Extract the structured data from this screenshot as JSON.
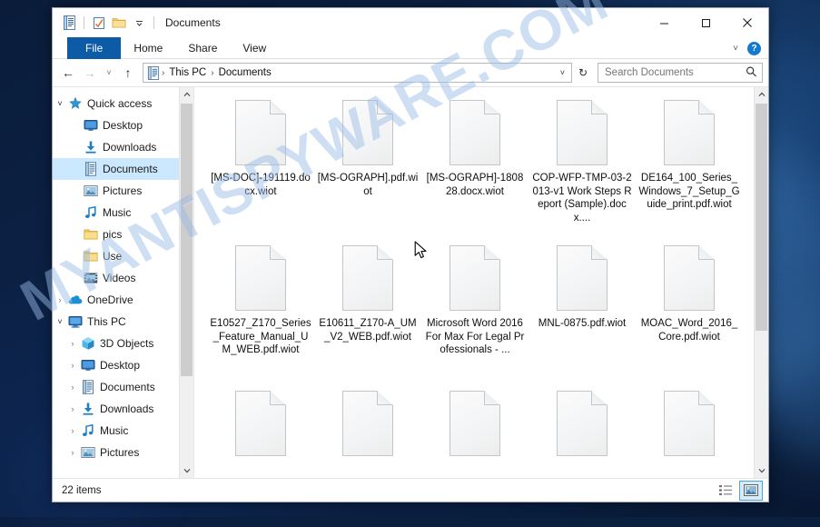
{
  "window": {
    "title": "Documents",
    "quick_access_toolbar": [
      {
        "name": "properties-icon",
        "label": "Properties"
      },
      {
        "name": "new-folder-icon",
        "label": "New folder"
      },
      {
        "name": "customize-qat-chevron-icon",
        "label": "Customize Quick Access Toolbar"
      }
    ],
    "controls": {
      "minimize": "─",
      "maximize": "☐",
      "close": "✕"
    }
  },
  "ribbon": {
    "tabs": [
      {
        "label": "File",
        "active": true
      },
      {
        "label": "Home",
        "active": false
      },
      {
        "label": "Share",
        "active": false
      },
      {
        "label": "View",
        "active": false
      }
    ],
    "expand_chevron": "˅",
    "help_label": "?"
  },
  "address_bar": {
    "back": "←",
    "forward": "→",
    "recent": "˅",
    "up": "↑",
    "breadcrumbs": [
      "This PC",
      "Documents"
    ],
    "separator": "›",
    "dropdown_chevron": "˅",
    "refresh": "↻"
  },
  "search": {
    "placeholder": "Search Documents",
    "value": "",
    "icon": "search-icon"
  },
  "sidebar": {
    "groups": [
      {
        "label": "Quick access",
        "icon": "pin-star-icon",
        "expander": "˅",
        "level": 1,
        "selected": false,
        "pinned": false
      },
      {
        "label": "Desktop",
        "icon": "desktop-icon",
        "level": 2,
        "selected": false,
        "pinned": true
      },
      {
        "label": "Downloads",
        "icon": "downloads-icon",
        "level": 2,
        "selected": false,
        "pinned": true
      },
      {
        "label": "Documents",
        "icon": "documents-icon",
        "level": 2,
        "selected": true,
        "pinned": true
      },
      {
        "label": "Pictures",
        "icon": "pictures-icon",
        "level": 2,
        "selected": false,
        "pinned": true
      },
      {
        "label": "Music",
        "icon": "music-icon",
        "level": 2,
        "selected": false,
        "pinned": false
      },
      {
        "label": "pics",
        "icon": "folder-icon",
        "level": 2,
        "selected": false,
        "pinned": false
      },
      {
        "label": "Use",
        "icon": "folder-icon",
        "level": 2,
        "selected": false,
        "pinned": false
      },
      {
        "label": "Videos",
        "icon": "videos-icon",
        "level": 2,
        "selected": false,
        "pinned": false
      },
      {
        "label": "OneDrive",
        "icon": "onedrive-icon",
        "expander": "›",
        "level": 1,
        "selected": false,
        "pinned": false
      },
      {
        "label": "This PC",
        "icon": "thispc-icon",
        "expander": "˅",
        "level": 1,
        "selected": false,
        "pinned": false
      },
      {
        "label": "3D Objects",
        "icon": "3dobjects-icon",
        "expander": "›",
        "level": 2,
        "selected": false,
        "pinned": false
      },
      {
        "label": "Desktop",
        "icon": "desktop-icon",
        "expander": "›",
        "level": 2,
        "selected": false,
        "pinned": false
      },
      {
        "label": "Documents",
        "icon": "documents-icon",
        "expander": "›",
        "level": 2,
        "selected": false,
        "pinned": false
      },
      {
        "label": "Downloads",
        "icon": "downloads-icon",
        "expander": "›",
        "level": 2,
        "selected": false,
        "pinned": false
      },
      {
        "label": "Music",
        "icon": "music-icon",
        "expander": "›",
        "level": 2,
        "selected": false,
        "pinned": false
      },
      {
        "label": "Pictures",
        "icon": "pictures-icon",
        "expander": "›",
        "level": 2,
        "selected": false,
        "pinned": false
      }
    ],
    "pin_glyph": "📌"
  },
  "files": [
    {
      "name": "[MS-DOC]-191119.docx.wiot",
      "icon": "blank-file-icon"
    },
    {
      "name": "[MS-OGRAPH].pdf.wiot",
      "icon": "blank-file-icon"
    },
    {
      "name": "[MS-OGRAPH]-180828.docx.wiot",
      "icon": "blank-file-icon"
    },
    {
      "name": "COP-WFP-TMP-03-2013-v1 Work Steps Report (Sample).docx....",
      "icon": "blank-file-icon"
    },
    {
      "name": "DE164_100_Series_Windows_7_Setup_Guide_print.pdf.wiot",
      "icon": "blank-file-icon"
    },
    {
      "name": "E10527_Z170_Series_Feature_Manual_UM_WEB.pdf.wiot",
      "icon": "blank-file-icon"
    },
    {
      "name": "E10611_Z170-A_UM_V2_WEB.pdf.wiot",
      "icon": "blank-file-icon"
    },
    {
      "name": "Microsoft Word 2016 For Max For Legal Professionals - ...",
      "icon": "blank-file-icon"
    },
    {
      "name": "MNL-0875.pdf.wiot",
      "icon": "blank-file-icon"
    },
    {
      "name": "MOAC_Word_2016_Core.pdf.wiot",
      "icon": "blank-file-icon"
    },
    {
      "name": "",
      "icon": "blank-file-icon"
    },
    {
      "name": "",
      "icon": "blank-file-icon"
    },
    {
      "name": "",
      "icon": "blank-file-icon"
    },
    {
      "name": "",
      "icon": "blank-file-icon"
    },
    {
      "name": "",
      "icon": "blank-file-icon"
    }
  ],
  "status_bar": {
    "item_count": "22 items",
    "views": [
      {
        "name": "details-view-button",
        "active": false
      },
      {
        "name": "large-icons-view-button",
        "active": true
      }
    ]
  },
  "watermark": {
    "text": "MYANTISPYWARE.COM"
  },
  "colors": {
    "accent": "#0d5ba6",
    "selection": "#cce8ff",
    "desktop": "#0b1f3f",
    "watermark": "#6096d7"
  }
}
